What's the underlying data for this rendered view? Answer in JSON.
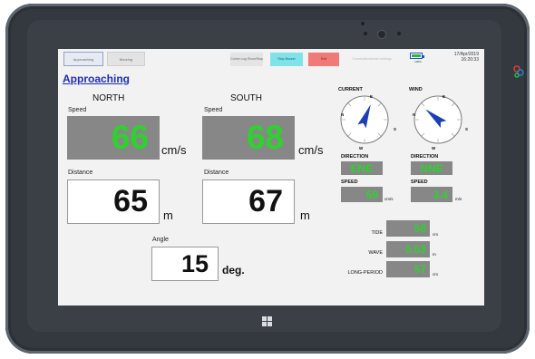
{
  "toolbar": {
    "tab_approaching": "Approaching",
    "tab_mooring": "Mooring",
    "comm_log_label": "Comm Log Show/Stop",
    "stop_buzzer_label": "Stop Buzzer",
    "exit_label": "Exit",
    "disabled_label": "Connection/stream settings",
    "battery_label": "100%",
    "date": "17/Apr/2019",
    "time": "16:20:33"
  },
  "page_title": "Approaching",
  "north": {
    "title": "NORTH",
    "speed_label": "Speed",
    "speed_value": "66",
    "speed_unit": "cm/s",
    "distance_label": "Distance",
    "distance_value": "65",
    "distance_unit": "m"
  },
  "south": {
    "title": "SOUTH",
    "speed_label": "Speed",
    "speed_value": "68",
    "speed_unit": "cm/s",
    "distance_label": "Distance",
    "distance_value": "67",
    "distance_unit": "m"
  },
  "angle": {
    "label": "Angle",
    "value": "15",
    "unit": "deg."
  },
  "current": {
    "title": "CURRENT",
    "direction_label": "DIRECTION",
    "direction_value": "ENE",
    "speed_label": "SPEED",
    "speed_value": "59",
    "speed_unit": "cm/s",
    "heading_deg": 22
  },
  "wind": {
    "title": "WIND",
    "direction_label": "DIRECTION",
    "direction_value": "NNE",
    "speed_label": "SPEED",
    "speed_value": "3.4",
    "speed_unit": "m/s",
    "heading_deg": -50
  },
  "compass_letters": {
    "n": "N",
    "e": "E",
    "s": "S",
    "w": "W"
  },
  "tide": {
    "label": "TIDE",
    "value": "58",
    "unit": "cm"
  },
  "wave": {
    "label": "WAVE",
    "value": "0.53",
    "unit": "m"
  },
  "long_period": {
    "label": "LONG-PERIOD",
    "value": "57",
    "unit": "cm"
  },
  "colors": {
    "accent_title": "#1f2fb0",
    "value_green": "#2fd12f",
    "box_gray": "#878787",
    "stop_buzzer": "#7fe3e8",
    "exit": "#f07a78",
    "compass_needle": "#1d3fb5"
  },
  "icons": {
    "windows_key": "windows-logo-icon",
    "battery": "battery-icon"
  }
}
